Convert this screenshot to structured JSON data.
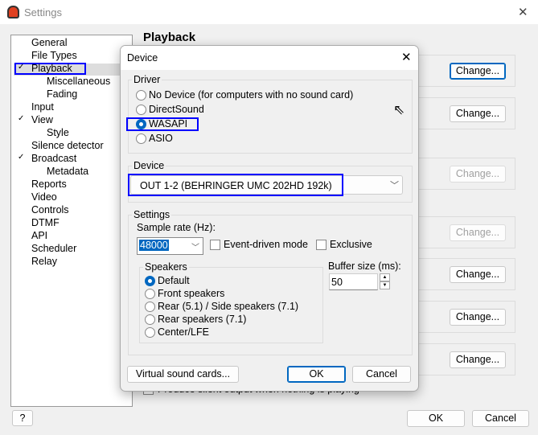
{
  "window": {
    "title": "Settings",
    "close": "✕"
  },
  "tree": [
    {
      "label": "General",
      "indent": 0
    },
    {
      "label": "File Types",
      "indent": 0
    },
    {
      "label": "Playback",
      "indent": 0,
      "expanded": true,
      "selected": true
    },
    {
      "label": "Miscellaneous",
      "indent": 1
    },
    {
      "label": "Fading",
      "indent": 1
    },
    {
      "label": "Input",
      "indent": 0
    },
    {
      "label": "View",
      "indent": 0,
      "expanded": true
    },
    {
      "label": "Style",
      "indent": 1
    },
    {
      "label": "Silence detector",
      "indent": 0
    },
    {
      "label": "Broadcast",
      "indent": 0,
      "expanded": true
    },
    {
      "label": "Metadata",
      "indent": 1
    },
    {
      "label": "Reports",
      "indent": 0
    },
    {
      "label": "Video",
      "indent": 0
    },
    {
      "label": "Controls",
      "indent": 0
    },
    {
      "label": "DTMF",
      "indent": 0
    },
    {
      "label": "API",
      "indent": 0
    },
    {
      "label": "Scheduler",
      "indent": 0
    },
    {
      "label": "Relay",
      "indent": 0
    }
  ],
  "main": {
    "heading": "Playback",
    "change_label": "Change...",
    "silent_output_label": "Produce silent output when nothing is playing",
    "help": "?",
    "ok": "OK",
    "cancel": "Cancel"
  },
  "dialog": {
    "title": "Device",
    "close": "✕",
    "driver": {
      "label": "Driver",
      "options": [
        "No Device (for computers with no sound card)",
        "DirectSound",
        "WASAPI",
        "ASIO"
      ],
      "selected": "WASAPI"
    },
    "device": {
      "label": "Device",
      "value": "OUT 1-2 (BEHRINGER UMC 202HD 192k)"
    },
    "settings": {
      "label": "Settings",
      "sample_rate_label": "Sample rate (Hz):",
      "sample_rate": "48000",
      "event_driven": "Event-driven mode",
      "exclusive": "Exclusive",
      "speakers": {
        "label": "Speakers",
        "options": [
          "Default",
          "Front speakers",
          "Rear (5.1) / Side speakers (7.1)",
          "Rear speakers (7.1)",
          "Center/LFE"
        ],
        "selected": "Default"
      },
      "buffer_label": "Buffer size (ms):",
      "buffer": "50"
    },
    "virtual": "Virtual sound cards...",
    "ok": "OK",
    "cancel": "Cancel"
  },
  "colors": {
    "accent": "#0067c0",
    "highlight_box": "#0000ff"
  }
}
